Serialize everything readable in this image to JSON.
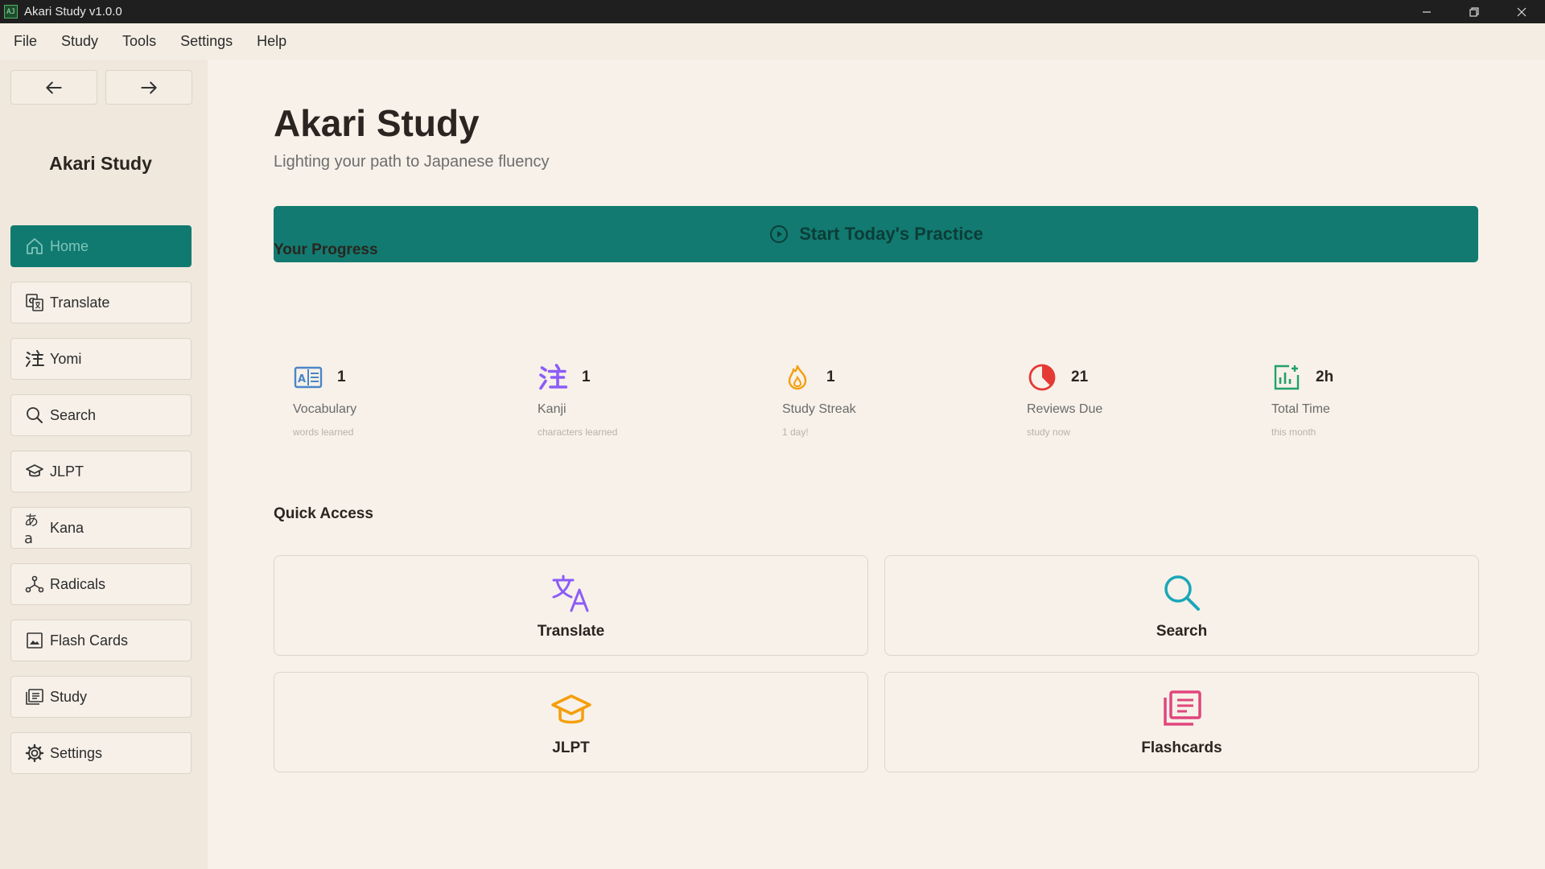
{
  "window": {
    "title": "Akari Study v1.0.0",
    "icon_text": "AJ"
  },
  "menubar": {
    "items": [
      "File",
      "Study",
      "Tools",
      "Settings",
      "Help"
    ]
  },
  "sidebar": {
    "brand": "Akari Study",
    "items": [
      {
        "label": "Home",
        "icon": "home-icon",
        "active": true
      },
      {
        "label": "Translate",
        "icon": "translate-icon"
      },
      {
        "label": "Yomi",
        "icon": "kanji-icon"
      },
      {
        "label": "Search",
        "icon": "search-icon"
      },
      {
        "label": "JLPT",
        "icon": "graduation-cap-icon"
      },
      {
        "label": "Kana",
        "icon": "kana-icon",
        "glyph": "あa"
      },
      {
        "label": "Radicals",
        "icon": "radicals-icon"
      },
      {
        "label": "Flash Cards",
        "icon": "image-card-icon"
      },
      {
        "label": "Study",
        "icon": "study-icon"
      },
      {
        "label": "Settings",
        "icon": "gear-icon"
      }
    ]
  },
  "main": {
    "title": "Akari Study",
    "subtitle": "Lighting your path to Japanese fluency",
    "cta_label": "Start Today's Practice",
    "progress_title": "Your Progress",
    "stats": [
      {
        "value": "1",
        "label": "Vocabulary",
        "sub": "words learned",
        "icon": "book-icon",
        "color": "#4a86c8"
      },
      {
        "value": "1",
        "label": "Kanji",
        "sub": "characters learned",
        "icon": "kanji-icon",
        "color": "#8b5cf6"
      },
      {
        "value": "1",
        "label": "Study Streak",
        "sub": "1 day!",
        "icon": "flame-icon",
        "color": "#f59e0b"
      },
      {
        "value": "21",
        "label": "Reviews Due",
        "sub": "study now",
        "icon": "pie-chart-icon",
        "color": "#e53935"
      },
      {
        "value": "2h",
        "label": "Total Time",
        "sub": "this month",
        "icon": "bar-chart-icon",
        "color": "#22a06b"
      }
    ],
    "quick_title": "Quick Access",
    "quick": [
      {
        "label": "Translate",
        "icon": "translate-icon",
        "color": "#8b5cf6"
      },
      {
        "label": "Search",
        "icon": "search-icon",
        "color": "#1aa7b8"
      },
      {
        "label": "JLPT",
        "icon": "graduation-cap-icon",
        "color": "#f59e0b"
      },
      {
        "label": "Flashcards",
        "icon": "flashcards-icon",
        "color": "#e0467c"
      }
    ]
  },
  "colors": {
    "accent": "#127a70",
    "background": "#f7f1e9",
    "sidebar": "#f0e8dd"
  }
}
